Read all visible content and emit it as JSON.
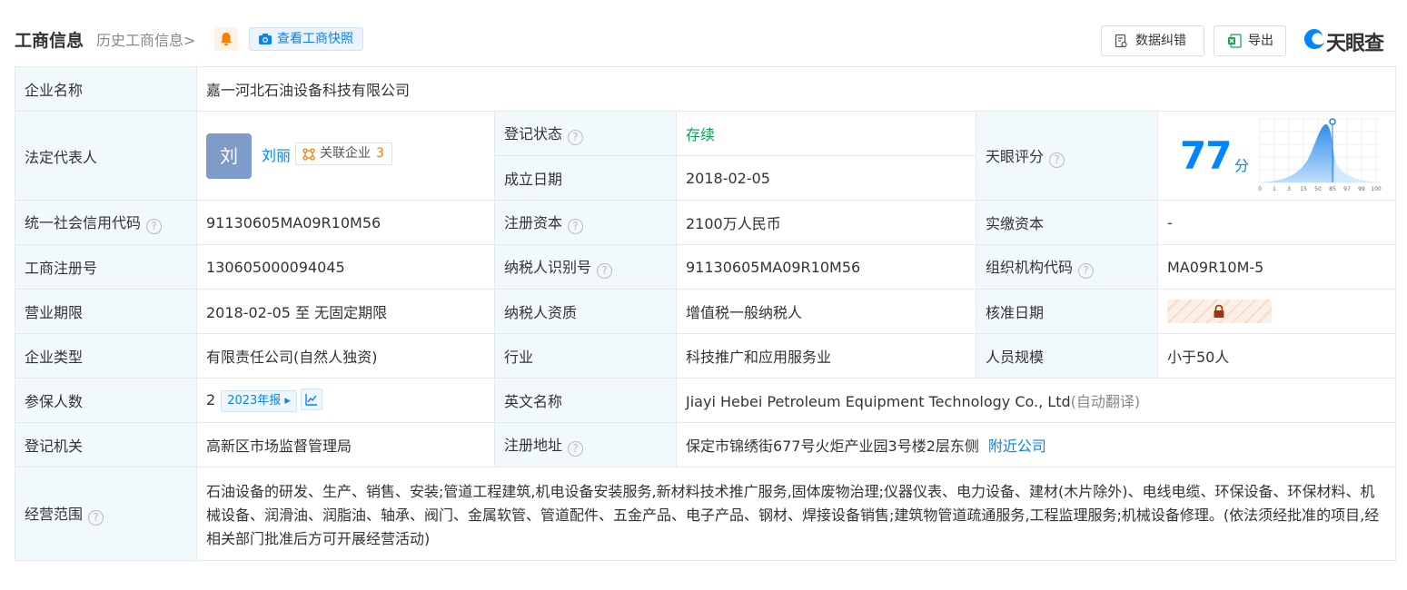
{
  "header": {
    "title": "工商信息",
    "history": "历史工商信息>",
    "snapshot": "查看工商快照",
    "correct": "数据纠错",
    "export": "导出",
    "logo": "天眼查"
  },
  "labels": {
    "company_name": "企业名称",
    "legal_rep": "法定代表人",
    "reg_status": "登记状态",
    "found_date": "成立日期",
    "tianyan_score": "天眼评分",
    "credit_code": "统一社会信用代码",
    "reg_capital": "注册资本",
    "paid_capital": "实缴资本",
    "reg_no": "工商注册号",
    "taxpayer_id": "纳税人识别号",
    "org_code": "组织机构代码",
    "term": "营业期限",
    "taxpayer_qual": "纳税人资质",
    "approve_date": "核准日期",
    "company_type": "企业类型",
    "industry": "行业",
    "staff_size": "人员规模",
    "insured": "参保人数",
    "english_name": "英文名称",
    "reg_authority": "登记机关",
    "reg_address": "注册地址",
    "business_scope": "经营范围"
  },
  "values": {
    "company_name": "嘉一河北石油设备科技有限公司",
    "avatar": "刘",
    "legal_rep": "刘丽",
    "related_label": "关联企业",
    "related_count": "3",
    "reg_status": "存续",
    "found_date": "2018-02-05",
    "score": "77",
    "score_unit": "分",
    "credit_code": "91130605MA09R10M56",
    "reg_capital": "2100万人民币",
    "paid_capital": "-",
    "reg_no": "130605000094045",
    "taxpayer_id": "91130605MA09R10M56",
    "org_code": "MA09R10M-5",
    "term": "2018-02-05 至 无固定期限",
    "taxpayer_qual": "增值税一般纳税人",
    "company_type": "有限责任公司(自然人独资)",
    "industry": "科技推广和应用服务业",
    "staff_size": "小于50人",
    "insured": "2",
    "insured_year": "2023年报",
    "english_name": "Jiayi Hebei Petroleum Equipment Technology Co., Ltd",
    "english_auto": "(自动翻译)",
    "reg_authority": "高新区市场监督管理局",
    "reg_address": "保定市锦绣街677号火炬产业园3号楼2层东侧",
    "nearby": "附近公司",
    "business_scope": "石油设备的研发、生产、销售、安装;管道工程建筑,机电设备安装服务,新材料技术推广服务,固体废物治理;仪器仪表、电力设备、建材(木片除外)、电线电缆、环保设备、环保材料、机械设备、润滑油、润脂油、轴承、阀门、金属软管、管道配件、五金产品、电子产品、钢材、焊接设备销售;建筑物管道疏通服务,工程监理服务;机械设备修理。(依法须经批准的项目,经相关部门批准后方可开展经营活动)"
  },
  "score_axis": [
    "0",
    "1",
    "3",
    "15",
    "50",
    "85",
    "97",
    "99",
    "100"
  ],
  "colors": {
    "accent": "#0084ff",
    "status_green": "#00a54b",
    "label_bg": "#f2f9fc"
  }
}
